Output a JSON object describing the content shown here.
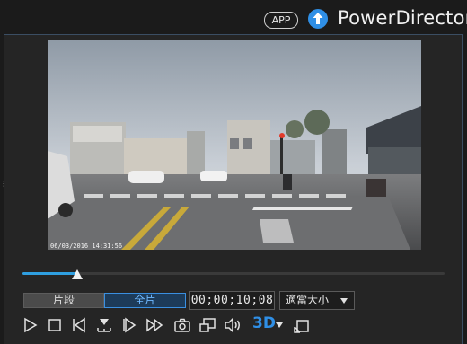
{
  "header": {
    "app_badge": "APP",
    "product_name": "PowerDirector"
  },
  "video": {
    "timestamp_overlay": "06/03/2016 14:31:56"
  },
  "playback": {
    "progress": 0.13,
    "mode_tabs": [
      {
        "label": "片段",
        "active": false
      },
      {
        "label": "全片",
        "active": true
      }
    ],
    "timecode": "00;00;10;08",
    "zoom_label": "適當大小",
    "label_3d": "3D"
  },
  "controls": [
    {
      "name": "play-icon"
    },
    {
      "name": "stop-icon"
    },
    {
      "name": "previous-frame-icon"
    },
    {
      "name": "split-icon"
    },
    {
      "name": "next-frame-icon"
    },
    {
      "name": "fast-forward-icon"
    },
    {
      "name": "snapshot-icon"
    },
    {
      "name": "picture-in-picture-icon"
    },
    {
      "name": "volume-icon"
    },
    {
      "name": "3d-icon"
    },
    {
      "name": "undock-icon"
    }
  ],
  "colors": {
    "accent": "#2f8fe6",
    "seek_fill": "#2f9fe0",
    "panel_border": "#3b4e63"
  }
}
